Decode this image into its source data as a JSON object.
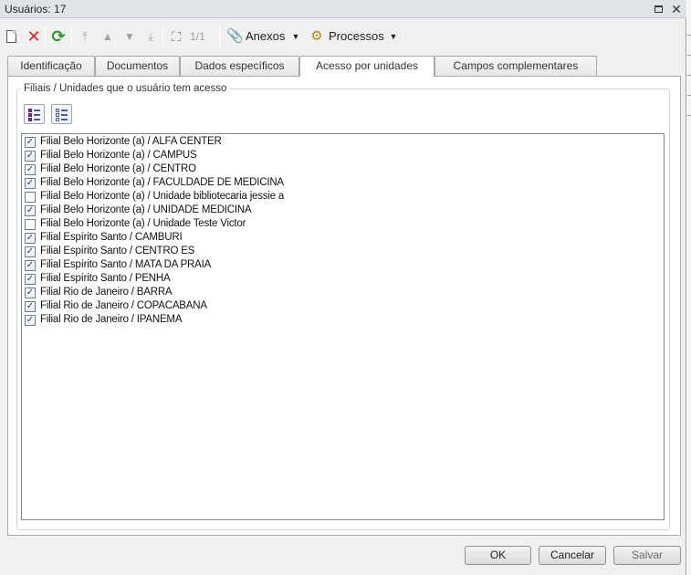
{
  "window": {
    "title": "Usuários: 17"
  },
  "toolbar": {
    "pager": "1/1",
    "attachments_label": "Anexos",
    "processes_label": "Processos",
    "icons": [
      "new-document-icon",
      "delete-icon",
      "refresh-icon",
      "first-record-icon",
      "previous-record-icon",
      "next-record-icon",
      "last-record-icon",
      "search-binoculars-icon",
      "paperclip-icon",
      "processes-gear-icon"
    ]
  },
  "tabs": [
    {
      "label": "Identificação"
    },
    {
      "label": "Documentos"
    },
    {
      "label": "Dados específicos"
    },
    {
      "label": "Acesso por unidades",
      "active": true
    },
    {
      "label": "Campos complementares"
    }
  ],
  "group": {
    "legend": "Filiais / Unidades que o usuário tem acesso"
  },
  "units": [
    {
      "label": "Filial Belo Horizonte (a) / ALFA CENTER",
      "checked": true
    },
    {
      "label": "Filial Belo Horizonte (a) / CAMPUS",
      "checked": true
    },
    {
      "label": "Filial Belo Horizonte (a) / CENTRO",
      "checked": true
    },
    {
      "label": "Filial Belo Horizonte (a) / FACULDADE DE MEDICINA",
      "checked": true
    },
    {
      "label": "Filial Belo Horizonte (a) / Unidade bibliotecaria jessie a",
      "checked": false
    },
    {
      "label": "Filial Belo Horizonte (a) / UNIDADE MEDICINA",
      "checked": true
    },
    {
      "label": "Filial Belo Horizonte (a) / Unidade Teste Victor",
      "checked": false
    },
    {
      "label": "Filial Espírito Santo / CAMBURI",
      "checked": true
    },
    {
      "label": "Filial Espírito Santo / CENTRO ES",
      "checked": true
    },
    {
      "label": "Filial Espírito Santo / MATA DA PRAIA",
      "checked": true
    },
    {
      "label": "Filial Espírito Santo / PENHA",
      "checked": true
    },
    {
      "label": "Filial Rio de Janeiro / BARRA",
      "checked": true
    },
    {
      "label": "Filial Rio de Janeiro / COPACABANA",
      "checked": true
    },
    {
      "label": "Filial Rio de Janeiro / IPANEMA",
      "checked": true
    }
  ],
  "footer": {
    "ok_label": "OK",
    "cancel_label": "Cancelar",
    "save_label": "Salvar"
  }
}
